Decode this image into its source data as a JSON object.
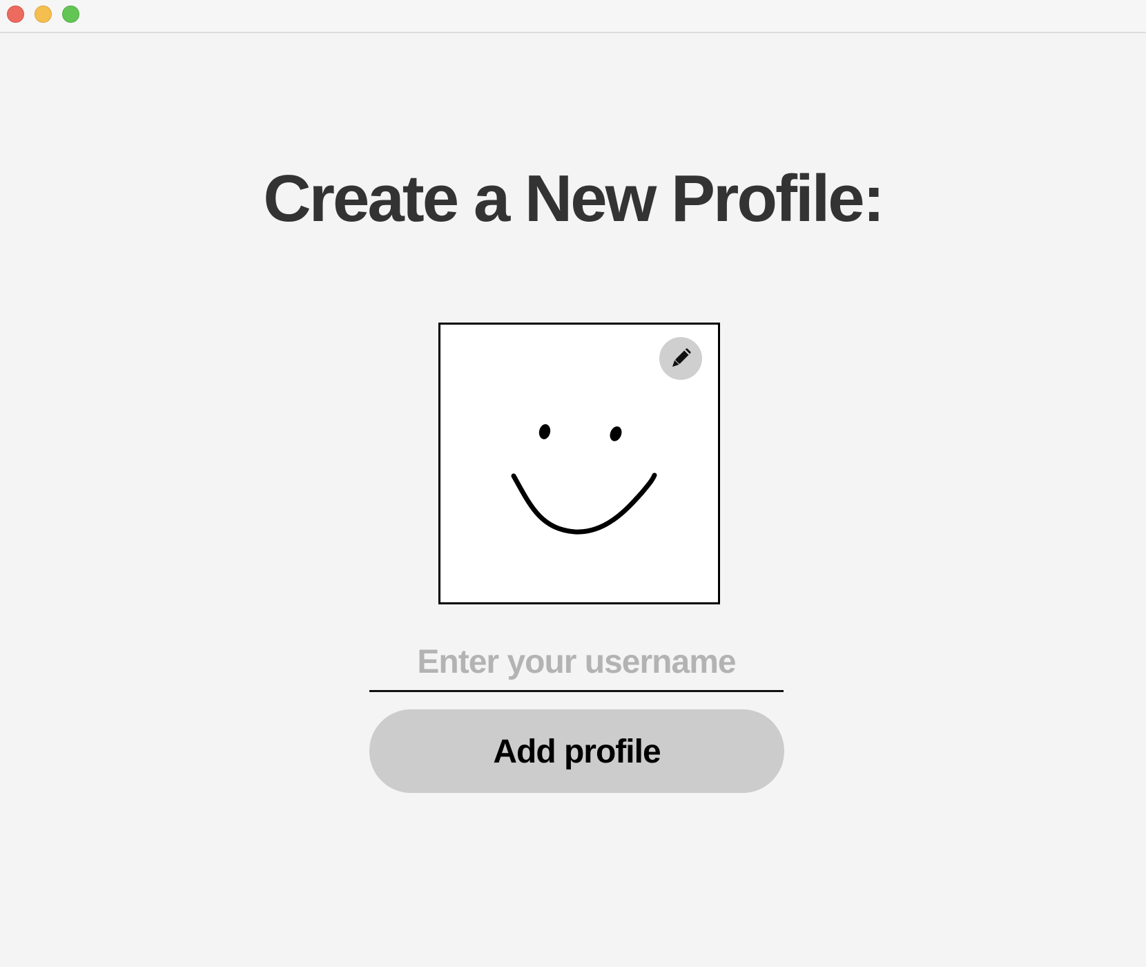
{
  "window": {
    "controls": {
      "close_icon": "close-icon",
      "minimize_icon": "minimize-icon",
      "maximize_icon": "maximize-icon",
      "close_color": "#ed6a5e",
      "minimize_color": "#f5bf4f",
      "maximize_color": "#62c554"
    }
  },
  "page": {
    "title": "Create a New Profile:"
  },
  "avatar": {
    "drawing": "smiley-face-icon",
    "edit_icon": "pencil-icon"
  },
  "username": {
    "value": "",
    "placeholder": "Enter your username"
  },
  "actions": {
    "add_profile_label": "Add profile"
  },
  "colors": {
    "background": "#f4f4f4",
    "title_text": "#333333",
    "button_background": "#cccccc",
    "placeholder_text": "#b3b3b3"
  }
}
